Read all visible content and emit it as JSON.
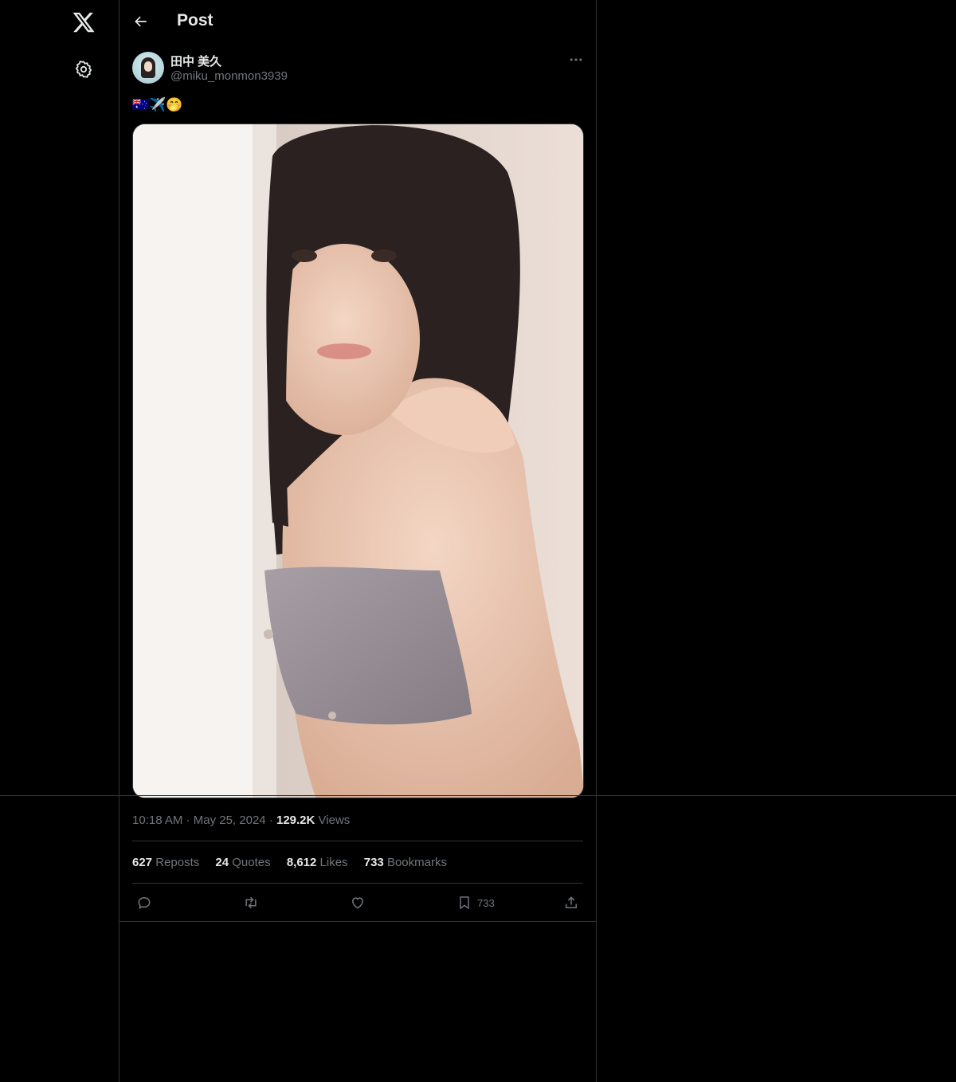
{
  "nav": {
    "logo_icon": "x-logo-icon",
    "settings_icon": "gear-icon"
  },
  "header": {
    "title": "Post",
    "back_icon": "arrow-left-icon"
  },
  "author": {
    "display_name": "田中 美久",
    "handle": "@miku_monmon3939"
  },
  "tweet": {
    "text": "🇦🇺✈️🤭",
    "time": "10:18 AM",
    "date": "May 25, 2024",
    "views_count": "129.2K",
    "views_label": "Views"
  },
  "stats": [
    {
      "count": "627",
      "label": "Reposts"
    },
    {
      "count": "24",
      "label": "Quotes"
    },
    {
      "count": "8,612",
      "label": "Likes"
    },
    {
      "count": "733",
      "label": "Bookmarks"
    }
  ],
  "actions": {
    "reply_icon": "reply-icon",
    "repost_icon": "repost-icon",
    "like_icon": "heart-icon",
    "bookmark_icon": "bookmark-icon",
    "bookmark_count": "733",
    "share_icon": "share-icon"
  },
  "colors": {
    "background": "#000000",
    "text": "#e7e9ea",
    "muted": "#71767b",
    "border": "#2f3336"
  }
}
